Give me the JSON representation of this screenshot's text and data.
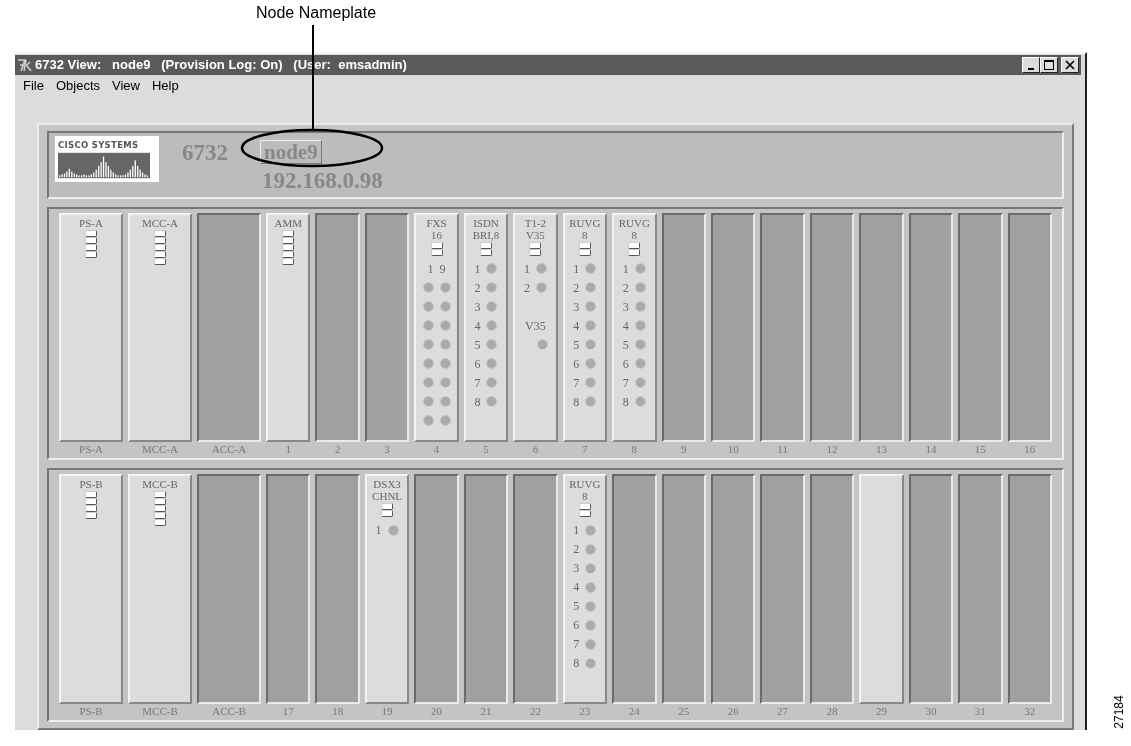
{
  "callout": {
    "label": "Node Nameplate"
  },
  "window": {
    "title": "6732 View:   node9   (Provision Log: On)   (User:  emsadmin)"
  },
  "menu": [
    "File",
    "Objects",
    "View",
    "Help"
  ],
  "nameplate": {
    "logo": "CISCO SYSTEMS",
    "model": "6732",
    "node_name": "node9",
    "ip_address": "192.168.0.98"
  },
  "shelves": [
    {
      "slots": [
        {
          "kind": "wide",
          "installed": true,
          "header": [
            "PS-A"
          ],
          "indicators": [
            {
              "kind": "bar"
            },
            {
              "kind": "bar"
            },
            {
              "kind": "bar"
            },
            {
              "kind": "bar"
            }
          ],
          "label": "PS-A"
        },
        {
          "kind": "wide",
          "installed": true,
          "header": [
            "MCC-A"
          ],
          "indicators": [
            {
              "kind": "bar"
            },
            {
              "kind": "bar"
            },
            {
              "kind": "bar"
            },
            {
              "kind": "bar"
            },
            {
              "kind": "bar"
            }
          ],
          "label": "MCC-A"
        },
        {
          "kind": "wide",
          "installed": false,
          "label": "ACC-A"
        },
        {
          "kind": "narrow",
          "installed": true,
          "header": [
            "AMM"
          ],
          "indicators": [
            {
              "kind": "bar"
            },
            {
              "kind": "bar"
            },
            {
              "kind": "bar"
            },
            {
              "kind": "bar"
            },
            {
              "kind": "bar"
            }
          ],
          "label": "1"
        },
        {
          "kind": "narrow",
          "installed": false,
          "label": "2"
        },
        {
          "kind": "narrow",
          "installed": false,
          "label": "3"
        },
        {
          "kind": "narrow",
          "installed": true,
          "header": [
            "FXS",
            "16"
          ],
          "indicators": [
            {
              "kind": "bar"
            },
            {
              "kind": "bar"
            }
          ],
          "label": "4",
          "rows": [
            {
              "cells": [
                {
                  "kind": "text",
                  "text": "1"
                },
                {
                  "kind": "text",
                  "text": "9"
                }
              ]
            },
            {
              "cells": [
                {
                  "kind": "led"
                },
                {
                  "kind": "led"
                }
              ]
            },
            {
              "cells": [
                {
                  "kind": "led"
                },
                {
                  "kind": "led"
                }
              ]
            },
            {
              "cells": [
                {
                  "kind": "led"
                },
                {
                  "kind": "led"
                }
              ]
            },
            {
              "cells": [
                {
                  "kind": "led"
                },
                {
                  "kind": "led"
                }
              ]
            },
            {
              "cells": [
                {
                  "kind": "led"
                },
                {
                  "kind": "led"
                }
              ]
            },
            {
              "cells": [
                {
                  "kind": "led"
                },
                {
                  "kind": "led"
                }
              ]
            },
            {
              "cells": [
                {
                  "kind": "led"
                },
                {
                  "kind": "led"
                }
              ]
            },
            {
              "cells": [
                {
                  "kind": "led"
                },
                {
                  "kind": "led"
                }
              ]
            }
          ]
        },
        {
          "kind": "narrow",
          "installed": true,
          "header": [
            "ISDN",
            "BRI,8"
          ],
          "indicators": [
            {
              "kind": "bar"
            },
            {
              "kind": "bar"
            }
          ],
          "label": "5",
          "rows": [
            {
              "cells": [
                {
                  "kind": "text",
                  "text": "1"
                },
                {
                  "kind": "led"
                }
              ]
            },
            {
              "cells": [
                {
                  "kind": "text",
                  "text": "2"
                },
                {
                  "kind": "led"
                }
              ]
            },
            {
              "cells": [
                {
                  "kind": "text",
                  "text": "3"
                },
                {
                  "kind": "led"
                }
              ]
            },
            {
              "cells": [
                {
                  "kind": "text",
                  "text": "4"
                },
                {
                  "kind": "led"
                }
              ]
            },
            {
              "cells": [
                {
                  "kind": "text",
                  "text": "5"
                },
                {
                  "kind": "led"
                }
              ]
            },
            {
              "cells": [
                {
                  "kind": "text",
                  "text": "6"
                },
                {
                  "kind": "led"
                }
              ]
            },
            {
              "cells": [
                {
                  "kind": "text",
                  "text": "7"
                },
                {
                  "kind": "led"
                }
              ]
            },
            {
              "cells": [
                {
                  "kind": "text",
                  "text": "8"
                },
                {
                  "kind": "led"
                }
              ]
            }
          ]
        },
        {
          "kind": "narrow",
          "installed": true,
          "header": [
            "T1-2",
            "V35"
          ],
          "indicators": [
            {
              "kind": "bar"
            },
            {
              "kind": "bar"
            }
          ],
          "label": "6",
          "rows": [
            {
              "cells": [
                {
                  "kind": "text",
                  "text": "1"
                },
                {
                  "kind": "led"
                }
              ]
            },
            {
              "cells": [
                {
                  "kind": "text",
                  "text": "2"
                },
                {
                  "kind": "led"
                }
              ]
            },
            {
              "cells": [
                {
                  "kind": "spacer"
                }
              ]
            },
            {
              "cells": [
                {
                  "kind": "text",
                  "text": "V35"
                }
              ]
            },
            {
              "cells": [
                {
                  "kind": "spacer"
                },
                {
                  "kind": "led"
                }
              ]
            }
          ]
        },
        {
          "kind": "narrow",
          "installed": true,
          "header": [
            "RUVG",
            "8"
          ],
          "indicators": [
            {
              "kind": "bar"
            },
            {
              "kind": "bar"
            }
          ],
          "label": "7",
          "rows": [
            {
              "cells": [
                {
                  "kind": "text",
                  "text": "1"
                },
                {
                  "kind": "led"
                }
              ]
            },
            {
              "cells": [
                {
                  "kind": "text",
                  "text": "2"
                },
                {
                  "kind": "led"
                }
              ]
            },
            {
              "cells": [
                {
                  "kind": "text",
                  "text": "3"
                },
                {
                  "kind": "led"
                }
              ]
            },
            {
              "cells": [
                {
                  "kind": "text",
                  "text": "4"
                },
                {
                  "kind": "led"
                }
              ]
            },
            {
              "cells": [
                {
                  "kind": "text",
                  "text": "5"
                },
                {
                  "kind": "led"
                }
              ]
            },
            {
              "cells": [
                {
                  "kind": "text",
                  "text": "6"
                },
                {
                  "kind": "led"
                }
              ]
            },
            {
              "cells": [
                {
                  "kind": "text",
                  "text": "7"
                },
                {
                  "kind": "led"
                }
              ]
            },
            {
              "cells": [
                {
                  "kind": "text",
                  "text": "8"
                },
                {
                  "kind": "led"
                }
              ]
            }
          ]
        },
        {
          "kind": "narrow",
          "installed": true,
          "header": [
            "RUVG",
            "8"
          ],
          "indicators": [
            {
              "kind": "bar"
            },
            {
              "kind": "bar"
            }
          ],
          "label": "8",
          "rows": [
            {
              "cells": [
                {
                  "kind": "text",
                  "text": "1"
                },
                {
                  "kind": "led"
                }
              ]
            },
            {
              "cells": [
                {
                  "kind": "text",
                  "text": "2"
                },
                {
                  "kind": "led"
                }
              ]
            },
            {
              "cells": [
                {
                  "kind": "text",
                  "text": "3"
                },
                {
                  "kind": "led"
                }
              ]
            },
            {
              "cells": [
                {
                  "kind": "text",
                  "text": "4"
                },
                {
                  "kind": "led"
                }
              ]
            },
            {
              "cells": [
                {
                  "kind": "text",
                  "text": "5"
                },
                {
                  "kind": "led"
                }
              ]
            },
            {
              "cells": [
                {
                  "kind": "text",
                  "text": "6"
                },
                {
                  "kind": "led"
                }
              ]
            },
            {
              "cells": [
                {
                  "kind": "text",
                  "text": "7"
                },
                {
                  "kind": "led"
                }
              ]
            },
            {
              "cells": [
                {
                  "kind": "text",
                  "text": "8"
                },
                {
                  "kind": "led"
                }
              ]
            }
          ]
        },
        {
          "kind": "narrow",
          "installed": false,
          "label": "9"
        },
        {
          "kind": "narrow",
          "installed": false,
          "label": "10"
        },
        {
          "kind": "narrow",
          "installed": false,
          "label": "11"
        },
        {
          "kind": "narrow",
          "installed": false,
          "label": "12"
        },
        {
          "kind": "narrow",
          "installed": false,
          "label": "13"
        },
        {
          "kind": "narrow",
          "installed": false,
          "label": "14"
        },
        {
          "kind": "narrow",
          "installed": false,
          "label": "15"
        },
        {
          "kind": "narrow",
          "installed": false,
          "label": "16"
        }
      ]
    },
    {
      "slots": [
        {
          "kind": "wide",
          "installed": true,
          "header": [
            "PS-B"
          ],
          "indicators": [
            {
              "kind": "bar"
            },
            {
              "kind": "bar"
            },
            {
              "kind": "bar"
            },
            {
              "kind": "bar"
            }
          ],
          "label": "PS-B"
        },
        {
          "kind": "wide",
          "installed": true,
          "header": [
            "MCC-B"
          ],
          "indicators": [
            {
              "kind": "bar"
            },
            {
              "kind": "bar"
            },
            {
              "kind": "bar"
            },
            {
              "kind": "bar"
            },
            {
              "kind": "bar"
            }
          ],
          "label": "MCC-B"
        },
        {
          "kind": "wide",
          "installed": false,
          "label": "ACC-B"
        },
        {
          "kind": "narrow",
          "installed": false,
          "label": "17"
        },
        {
          "kind": "narrow",
          "installed": false,
          "label": "18"
        },
        {
          "kind": "narrow",
          "installed": true,
          "header": [
            "DSX3",
            "CHNL"
          ],
          "indicators": [
            {
              "kind": "bar"
            },
            {
              "kind": "bar"
            }
          ],
          "label": "19",
          "rows": [
            {
              "cells": [
                {
                  "kind": "text",
                  "text": "1"
                },
                {
                  "kind": "led"
                }
              ]
            }
          ]
        },
        {
          "kind": "narrow",
          "installed": false,
          "label": "20"
        },
        {
          "kind": "narrow",
          "installed": false,
          "label": "21"
        },
        {
          "kind": "narrow",
          "installed": false,
          "label": "22"
        },
        {
          "kind": "narrow",
          "installed": true,
          "header": [
            "RUVG",
            "8"
          ],
          "indicators": [
            {
              "kind": "bar"
            },
            {
              "kind": "bar"
            }
          ],
          "label": "23",
          "rows": [
            {
              "cells": [
                {
                  "kind": "text",
                  "text": "1"
                },
                {
                  "kind": "led"
                }
              ]
            },
            {
              "cells": [
                {
                  "kind": "text",
                  "text": "2"
                },
                {
                  "kind": "led"
                }
              ]
            },
            {
              "cells": [
                {
                  "kind": "text",
                  "text": "3"
                },
                {
                  "kind": "led"
                }
              ]
            },
            {
              "cells": [
                {
                  "kind": "text",
                  "text": "4"
                },
                {
                  "kind": "led"
                }
              ]
            },
            {
              "cells": [
                {
                  "kind": "text",
                  "text": "5"
                },
                {
                  "kind": "led"
                }
              ]
            },
            {
              "cells": [
                {
                  "kind": "text",
                  "text": "6"
                },
                {
                  "kind": "led"
                }
              ]
            },
            {
              "cells": [
                {
                  "kind": "text",
                  "text": "7"
                },
                {
                  "kind": "led"
                }
              ]
            },
            {
              "cells": [
                {
                  "kind": "text",
                  "text": "8"
                },
                {
                  "kind": "led"
                }
              ]
            }
          ]
        },
        {
          "kind": "narrow",
          "installed": false,
          "label": "24"
        },
        {
          "kind": "narrow",
          "installed": false,
          "label": "25"
        },
        {
          "kind": "narrow",
          "installed": false,
          "label": "26"
        },
        {
          "kind": "narrow",
          "installed": false,
          "label": "27"
        },
        {
          "kind": "narrow",
          "installed": false,
          "label": "28"
        },
        {
          "kind": "narrow",
          "installed": true,
          "label": "29"
        },
        {
          "kind": "narrow",
          "installed": false,
          "label": "30"
        },
        {
          "kind": "narrow",
          "installed": false,
          "label": "31"
        },
        {
          "kind": "narrow",
          "installed": false,
          "label": "32"
        }
      ]
    }
  ],
  "figure_id": "27184"
}
